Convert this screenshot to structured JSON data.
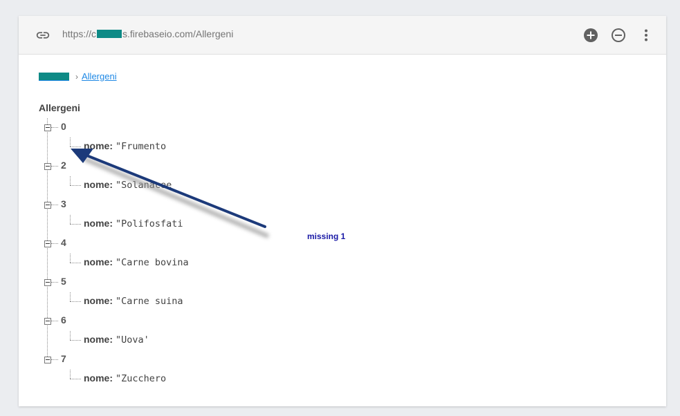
{
  "header": {
    "url_prefix": "https://c",
    "url_suffix": "s.firebaseio.com/Allergeni",
    "icons": [
      "link-icon",
      "add-circle-icon",
      "remove-circle-icon",
      "more-vert-icon"
    ]
  },
  "breadcrumb": {
    "current": "Allergeni",
    "separator": "›"
  },
  "tree": {
    "root": "Allergeni",
    "nodes": [
      {
        "key": "0",
        "field": "nome:",
        "value": "\"Frumento"
      },
      {
        "key": "2",
        "field": "nome:",
        "value": "\"Solanacee"
      },
      {
        "key": "3",
        "field": "nome:",
        "value": "\"Polifosfati"
      },
      {
        "key": "4",
        "field": "nome:",
        "value": "\"Carne bovina"
      },
      {
        "key": "5",
        "field": "nome:",
        "value": "\"Carne suina"
      },
      {
        "key": "6",
        "field": "nome:",
        "value": "\"Uova'"
      },
      {
        "key": "7",
        "field": "nome:",
        "value": "\"Zucchero"
      }
    ]
  },
  "annotation": {
    "text": "missing 1",
    "color": "#1a1aa6",
    "arrow_color": "#1c3a7a"
  },
  "colors": {
    "link": "#1e88e5",
    "redaction": "#0e8a86",
    "toolbar_bg": "#f5f5f5"
  }
}
